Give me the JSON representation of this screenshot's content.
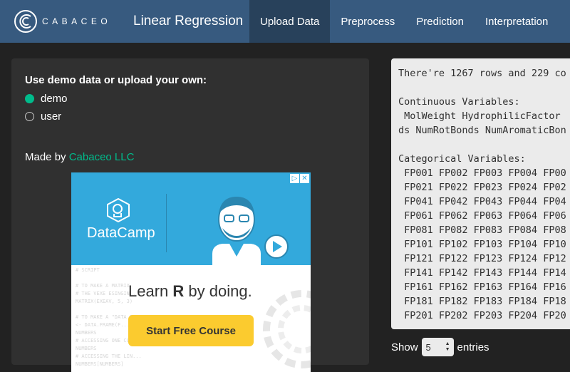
{
  "navbar": {
    "brand_text": "CABACEO",
    "app_title": "Linear Regression",
    "tabs": [
      {
        "label": "Upload Data",
        "active": true
      },
      {
        "label": "Preprocess",
        "active": false
      },
      {
        "label": "Prediction",
        "active": false
      },
      {
        "label": "Interpretation",
        "active": false
      }
    ]
  },
  "sidebar": {
    "data_source_label": "Use demo data or upload your own:",
    "options": [
      {
        "label": "demo",
        "checked": true
      },
      {
        "label": "user",
        "checked": false
      }
    ],
    "made_by_prefix": "Made by ",
    "made_by_link": "Cabaceo LLC"
  },
  "ad": {
    "brand": "DataCamp",
    "headline_prefix": "Learn ",
    "headline_bold": "R",
    "headline_suffix": " by doing.",
    "cta": "Start Free Course",
    "code_text": "# SCRIPT\n\n# TO MAKE A MATRIX\n# THE VEXE ESINGIN...\nMATRIX(EXEAV, 5, 3)\n\n# TO MAKE A \"DATA FRAME\"\n<- DATA.FRAME(F...\nNUMBERS\n# ACCESSING ONE COL\nNUMBERS\n# ACCESSING THE LIN...\nNUMBERS[NUMBERS]"
  },
  "output": {
    "text": "There're 1267 rows and 229 co\n\nContinuous Variables:\n MolWeight HydrophilicFactor \nds NumRotBonds NumAromaticBon\n\nCategorical Variables:\n FP001 FP002 FP003 FP004 FP00\n FP021 FP022 FP023 FP024 FP02\n FP041 FP042 FP043 FP044 FP04\n FP061 FP062 FP063 FP064 FP06\n FP081 FP082 FP083 FP084 FP08\n FP101 FP102 FP103 FP104 FP10\n FP121 FP122 FP123 FP124 FP12\n FP141 FP142 FP143 FP144 FP14\n FP161 FP162 FP163 FP164 FP16\n FP181 FP182 FP183 FP184 FP18\n FP201 FP202 FP203 FP204 FP20"
  },
  "table_controls": {
    "show_label": "Show",
    "entries_value": "5",
    "entries_label": "entries"
  },
  "colors": {
    "navbar": "#375a7f",
    "active_tab": "#28415b",
    "background": "#222222",
    "panel": "#303030",
    "accent": "#00bc8c",
    "ad_blue": "#33a9dc",
    "ad_cta": "#fbcb2f"
  }
}
